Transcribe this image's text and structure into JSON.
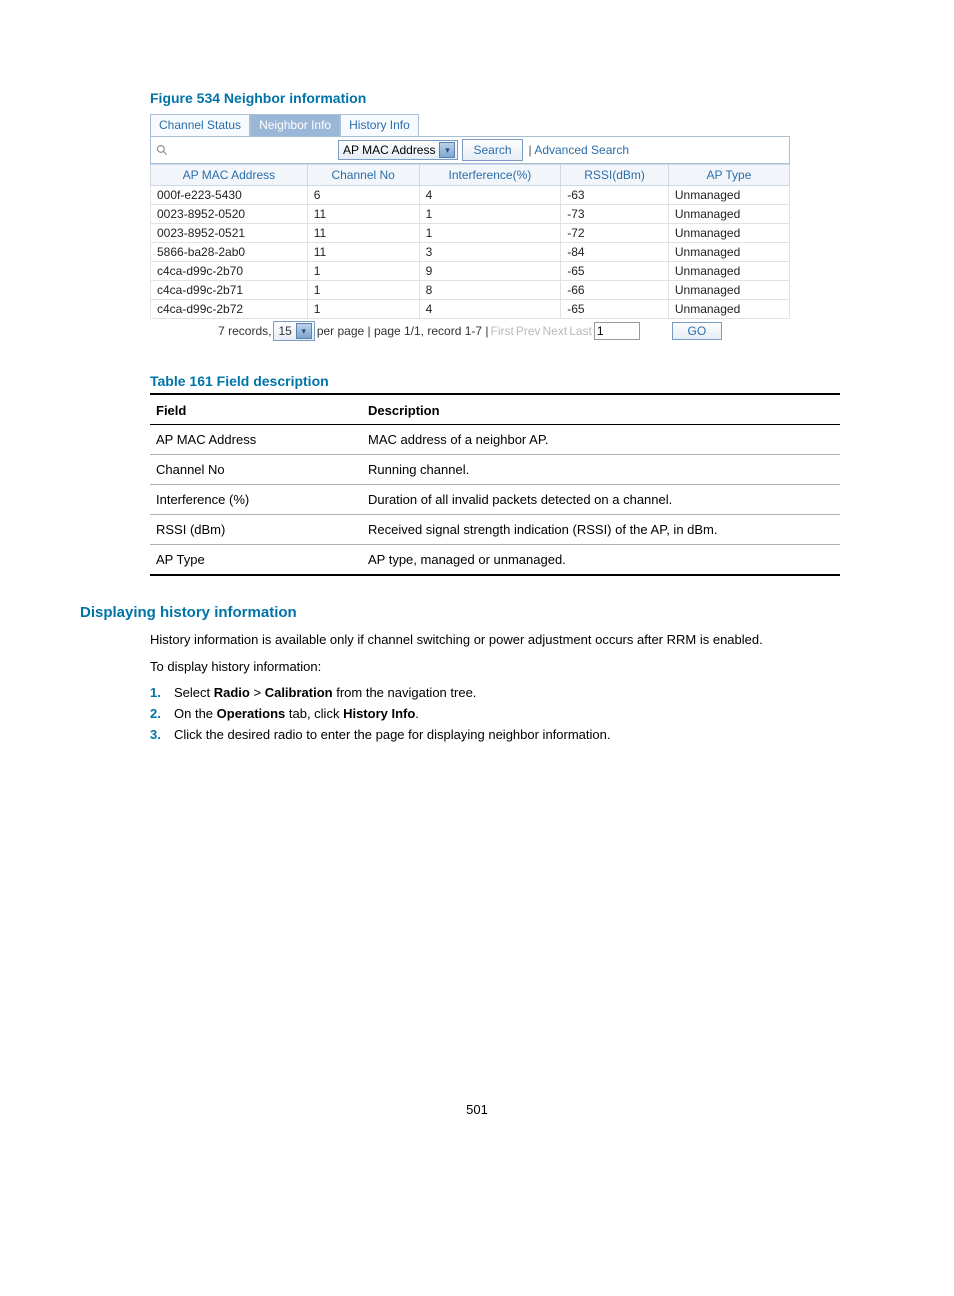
{
  "figure_title": "Figure 534 Neighbor information",
  "tabs": [
    "Channel Status",
    "Neighbor Info",
    "History Info"
  ],
  "active_tab": "Neighbor Info",
  "search": {
    "placeholder": "",
    "dropdown_selected": "AP MAC Address",
    "search_btn": "Search",
    "advanced": "Advanced Search"
  },
  "grid": {
    "headers": [
      "AP MAC Address",
      "Channel No",
      "Interference(%)",
      "RSSI(dBm)",
      "AP Type"
    ],
    "rows": [
      [
        "000f-e223-5430",
        "6",
        "4",
        "-63",
        "Unmanaged"
      ],
      [
        "0023-8952-0520",
        "11",
        "1",
        "-73",
        "Unmanaged"
      ],
      [
        "0023-8952-0521",
        "11",
        "1",
        "-72",
        "Unmanaged"
      ],
      [
        "5866-ba28-2ab0",
        "11",
        "3",
        "-84",
        "Unmanaged"
      ],
      [
        "c4ca-d99c-2b70",
        "1",
        "9",
        "-65",
        "Unmanaged"
      ],
      [
        "c4ca-d99c-2b71",
        "1",
        "8",
        "-66",
        "Unmanaged"
      ],
      [
        "c4ca-d99c-2b72",
        "1",
        "4",
        "-65",
        "Unmanaged"
      ]
    ]
  },
  "pager": {
    "records_prefix": "7 records,",
    "per_page_value": "15",
    "per_page_suffix": "per page | page 1/1, record 1-7 |",
    "first": "First",
    "prev": "Prev",
    "next": "Next",
    "last": "Last",
    "page_input": "1",
    "go": "GO"
  },
  "table_title": "Table 161 Field description",
  "desc_table": {
    "headers": [
      "Field",
      "Description"
    ],
    "rows": [
      [
        "AP MAC Address",
        "MAC address of a neighbor AP."
      ],
      [
        "Channel No",
        "Running channel."
      ],
      [
        "Interference (%)",
        "Duration of all invalid packets detected on a channel."
      ],
      [
        "RSSI (dBm)",
        "Received signal strength indication (RSSI) of the AP, in dBm."
      ],
      [
        "AP Type",
        "AP type, managed or unmanaged."
      ]
    ]
  },
  "section_title": "Displaying history information",
  "body": {
    "p1": "History information is available only if channel switching or power adjustment occurs after RRM is enabled.",
    "p2": "To display history information:",
    "steps": [
      {
        "n": "1.",
        "pre": "Select ",
        "b1": "Radio",
        "mid": " > ",
        "b2": "Calibration",
        "post": " from the navigation tree."
      },
      {
        "n": "2.",
        "pre": "On the ",
        "b1": "Operations",
        "mid": " tab, click ",
        "b2": "History Info",
        "post": "."
      },
      {
        "n": "3.",
        "pre": "Click the desired radio to enter the page for displaying neighbor information.",
        "b1": "",
        "mid": "",
        "b2": "",
        "post": ""
      }
    ]
  },
  "page_number": "501"
}
